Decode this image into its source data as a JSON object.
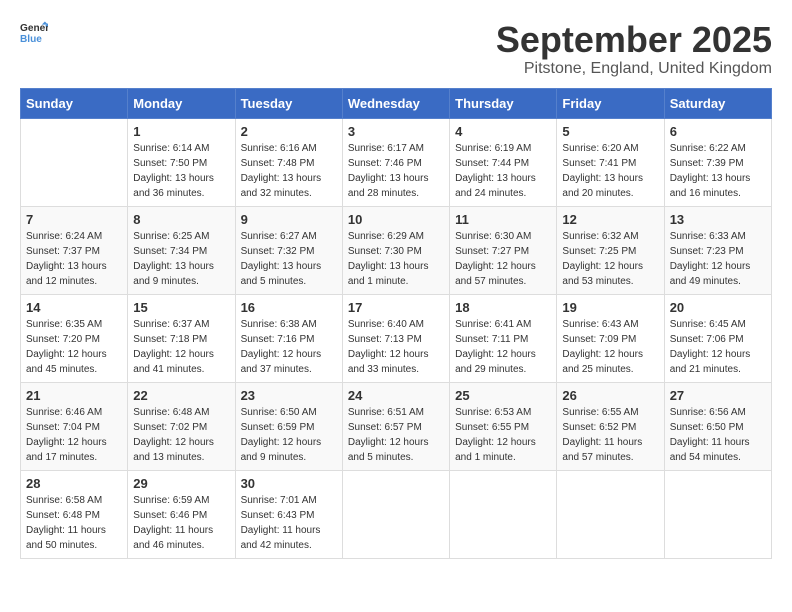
{
  "header": {
    "logo_general": "General",
    "logo_blue": "Blue",
    "month_title": "September 2025",
    "location": "Pitstone, England, United Kingdom"
  },
  "days_of_week": [
    "Sunday",
    "Monday",
    "Tuesday",
    "Wednesday",
    "Thursday",
    "Friday",
    "Saturday"
  ],
  "weeks": [
    [
      {
        "day": "",
        "info": ""
      },
      {
        "day": "1",
        "info": "Sunrise: 6:14 AM\nSunset: 7:50 PM\nDaylight: 13 hours\nand 36 minutes."
      },
      {
        "day": "2",
        "info": "Sunrise: 6:16 AM\nSunset: 7:48 PM\nDaylight: 13 hours\nand 32 minutes."
      },
      {
        "day": "3",
        "info": "Sunrise: 6:17 AM\nSunset: 7:46 PM\nDaylight: 13 hours\nand 28 minutes."
      },
      {
        "day": "4",
        "info": "Sunrise: 6:19 AM\nSunset: 7:44 PM\nDaylight: 13 hours\nand 24 minutes."
      },
      {
        "day": "5",
        "info": "Sunrise: 6:20 AM\nSunset: 7:41 PM\nDaylight: 13 hours\nand 20 minutes."
      },
      {
        "day": "6",
        "info": "Sunrise: 6:22 AM\nSunset: 7:39 PM\nDaylight: 13 hours\nand 16 minutes."
      }
    ],
    [
      {
        "day": "7",
        "info": "Sunrise: 6:24 AM\nSunset: 7:37 PM\nDaylight: 13 hours\nand 12 minutes."
      },
      {
        "day": "8",
        "info": "Sunrise: 6:25 AM\nSunset: 7:34 PM\nDaylight: 13 hours\nand 9 minutes."
      },
      {
        "day": "9",
        "info": "Sunrise: 6:27 AM\nSunset: 7:32 PM\nDaylight: 13 hours\nand 5 minutes."
      },
      {
        "day": "10",
        "info": "Sunrise: 6:29 AM\nSunset: 7:30 PM\nDaylight: 13 hours\nand 1 minute."
      },
      {
        "day": "11",
        "info": "Sunrise: 6:30 AM\nSunset: 7:27 PM\nDaylight: 12 hours\nand 57 minutes."
      },
      {
        "day": "12",
        "info": "Sunrise: 6:32 AM\nSunset: 7:25 PM\nDaylight: 12 hours\nand 53 minutes."
      },
      {
        "day": "13",
        "info": "Sunrise: 6:33 AM\nSunset: 7:23 PM\nDaylight: 12 hours\nand 49 minutes."
      }
    ],
    [
      {
        "day": "14",
        "info": "Sunrise: 6:35 AM\nSunset: 7:20 PM\nDaylight: 12 hours\nand 45 minutes."
      },
      {
        "day": "15",
        "info": "Sunrise: 6:37 AM\nSunset: 7:18 PM\nDaylight: 12 hours\nand 41 minutes."
      },
      {
        "day": "16",
        "info": "Sunrise: 6:38 AM\nSunset: 7:16 PM\nDaylight: 12 hours\nand 37 minutes."
      },
      {
        "day": "17",
        "info": "Sunrise: 6:40 AM\nSunset: 7:13 PM\nDaylight: 12 hours\nand 33 minutes."
      },
      {
        "day": "18",
        "info": "Sunrise: 6:41 AM\nSunset: 7:11 PM\nDaylight: 12 hours\nand 29 minutes."
      },
      {
        "day": "19",
        "info": "Sunrise: 6:43 AM\nSunset: 7:09 PM\nDaylight: 12 hours\nand 25 minutes."
      },
      {
        "day": "20",
        "info": "Sunrise: 6:45 AM\nSunset: 7:06 PM\nDaylight: 12 hours\nand 21 minutes."
      }
    ],
    [
      {
        "day": "21",
        "info": "Sunrise: 6:46 AM\nSunset: 7:04 PM\nDaylight: 12 hours\nand 17 minutes."
      },
      {
        "day": "22",
        "info": "Sunrise: 6:48 AM\nSunset: 7:02 PM\nDaylight: 12 hours\nand 13 minutes."
      },
      {
        "day": "23",
        "info": "Sunrise: 6:50 AM\nSunset: 6:59 PM\nDaylight: 12 hours\nand 9 minutes."
      },
      {
        "day": "24",
        "info": "Sunrise: 6:51 AM\nSunset: 6:57 PM\nDaylight: 12 hours\nand 5 minutes."
      },
      {
        "day": "25",
        "info": "Sunrise: 6:53 AM\nSunset: 6:55 PM\nDaylight: 12 hours\nand 1 minute."
      },
      {
        "day": "26",
        "info": "Sunrise: 6:55 AM\nSunset: 6:52 PM\nDaylight: 11 hours\nand 57 minutes."
      },
      {
        "day": "27",
        "info": "Sunrise: 6:56 AM\nSunset: 6:50 PM\nDaylight: 11 hours\nand 54 minutes."
      }
    ],
    [
      {
        "day": "28",
        "info": "Sunrise: 6:58 AM\nSunset: 6:48 PM\nDaylight: 11 hours\nand 50 minutes."
      },
      {
        "day": "29",
        "info": "Sunrise: 6:59 AM\nSunset: 6:46 PM\nDaylight: 11 hours\nand 46 minutes."
      },
      {
        "day": "30",
        "info": "Sunrise: 7:01 AM\nSunset: 6:43 PM\nDaylight: 11 hours\nand 42 minutes."
      },
      {
        "day": "",
        "info": ""
      },
      {
        "day": "",
        "info": ""
      },
      {
        "day": "",
        "info": ""
      },
      {
        "day": "",
        "info": ""
      }
    ]
  ]
}
